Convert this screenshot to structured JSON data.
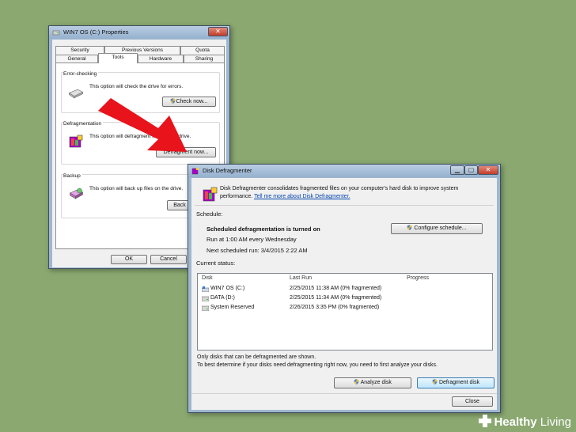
{
  "props_window": {
    "title": "WIN7 OS (C:) Properties",
    "close_glyph": "✕",
    "tabs_row1": [
      "Security",
      "Previous Versions",
      "Quota"
    ],
    "tabs_row2": [
      "General",
      "Tools",
      "Hardware",
      "Sharing"
    ],
    "active_tab": "Tools",
    "error_checking": {
      "label": "Error-checking",
      "text": "This option will check the drive for errors.",
      "button": "Check now..."
    },
    "defrag": {
      "label": "Defragmentation",
      "text": "This option will defragment files on the drive.",
      "button": "Defragment now..."
    },
    "backup": {
      "label": "Backup",
      "text": "This option will back up files on the drive.",
      "button": "Back up now..."
    },
    "ok_button": "OK",
    "cancel_button": "Cancel"
  },
  "defrag_window": {
    "title": "Disk Defragmenter",
    "intro_text": "Disk Defragmenter consolidates fragmented files on your computer's hard disk to improve system performance.",
    "intro_link": "Tell me more about Disk Defragmenter.",
    "schedule_label": "Schedule:",
    "schedule_status": "Scheduled defragmentation is turned on",
    "schedule_when": "Run at 1:00 AM every Wednesday",
    "next_run": "Next scheduled run: 3/4/2015 2:22 AM",
    "configure_button": "Configure schedule...",
    "current_status_label": "Current status:",
    "columns": [
      "Disk",
      "Last Run",
      "Progress"
    ],
    "disks": [
      {
        "name": "WIN7 OS (C:)",
        "last_run": "2/25/2015 11:38 AM (0% fragmented)",
        "progress": ""
      },
      {
        "name": "DATA (D:)",
        "last_run": "2/25/2015 11:34 AM (0% fragmented)",
        "progress": ""
      },
      {
        "name": "System Reserved",
        "last_run": "2/26/2015 3:35 PM (0% fragmented)",
        "progress": ""
      }
    ],
    "note_line1": "Only disks that can be defragmented are shown.",
    "note_line2": "To best determine if your disks need defragmenting right now, you need to first analyze your disks.",
    "analyze_button": "Analyze disk",
    "defragment_button": "Defragment disk",
    "close_button": "Close"
  },
  "watermark": {
    "prefix": "Healthy",
    "suffix": "Living"
  },
  "colors": {
    "background": "#8aa870",
    "arrow": "#e8131b",
    "titlebar": "#9fb7cf"
  }
}
